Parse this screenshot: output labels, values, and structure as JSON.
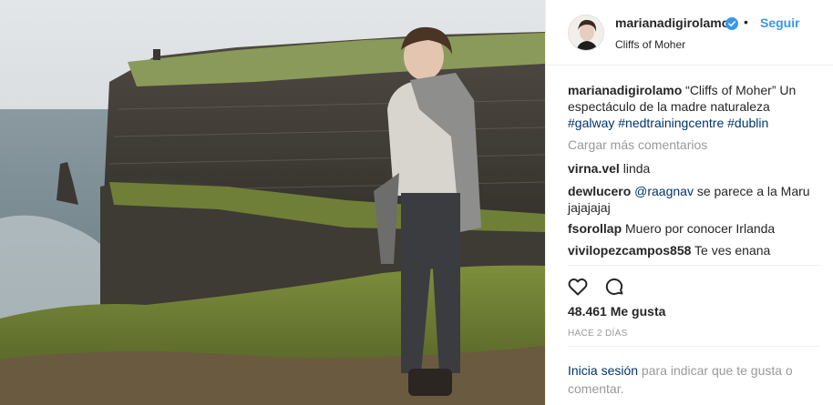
{
  "post": {
    "username": "marianadigirolamo",
    "follow_label": "Seguir",
    "separator": "•",
    "location": "Cliffs of Moher",
    "verified_icon": "verified-badge-icon"
  },
  "caption": {
    "username": "marianadigirolamo",
    "text": " “Cliffs of Moher” Un espectáculo de la madre naturaleza ",
    "hashtags": [
      "#galway",
      "#nedtrainingcentre",
      "#dublin"
    ]
  },
  "load_more": "Cargar más comentarios",
  "comments": [
    {
      "user": "virna.vel",
      "text": " linda"
    },
    {
      "user": "dewlucero",
      "mention": "@raagnav",
      "text": " se parece a la Maru jajajajaj"
    },
    {
      "user": "fsorollap",
      "text": " Muero por conocer Irlanda"
    },
    {
      "user": "vivilopezcampos858",
      "text": " Te ves enana"
    }
  ],
  "actions": {
    "like_icon": "heart-icon",
    "comment_icon": "comment-icon"
  },
  "likes": "48.461 Me gusta",
  "time_ago": "HACE 2 DÍAS",
  "login_prompt": {
    "link": "Inicia sesión",
    "text": " para indicar que te gusta o comentar."
  },
  "colors": {
    "link": "#003569",
    "follow": "#3897f0",
    "muted": "#999999",
    "text": "#262626",
    "divider": "#efefef"
  }
}
